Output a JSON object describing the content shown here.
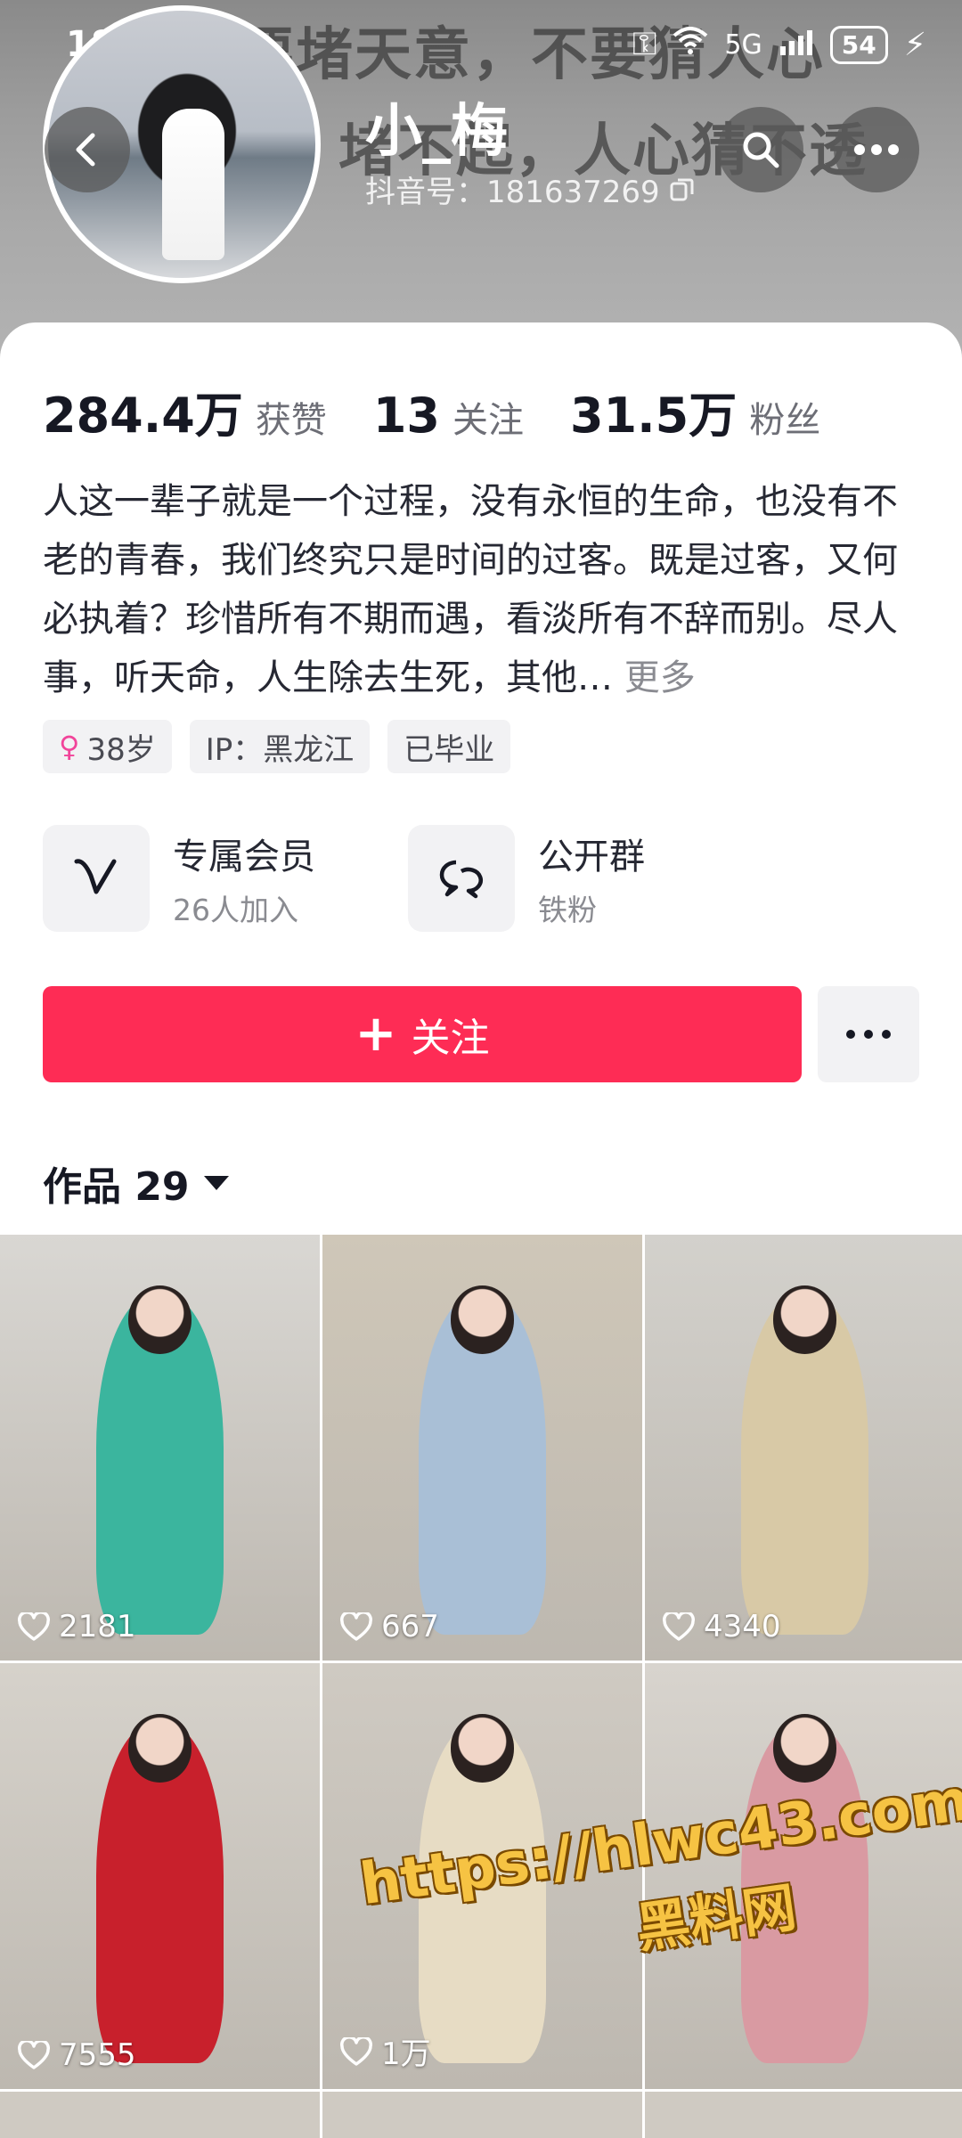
{
  "status_bar": {
    "time": "18:09",
    "network": "5G",
    "battery": "54"
  },
  "banner": {
    "line1": "不要堵天意，不要猜人心",
    "line2": "堵不起，人心猜不透"
  },
  "profile": {
    "username": "小_梅",
    "douyin_id": "抖音号：181637269"
  },
  "stats": [
    {
      "value": "284.4万",
      "label": "获赞"
    },
    {
      "value": "13",
      "label": "关注"
    },
    {
      "value": "31.5万",
      "label": "粉丝"
    }
  ],
  "bio": {
    "text": "人这一辈子就是一个过程，没有永恒的生命，也没有不老的青春，我们终究只是时间的过客。既是过客，又何必执着？珍惜所有不期而遇，看淡所有不辞而别。尽人事，听天命，人生除去生死，其他…",
    "more": "更多"
  },
  "tags": {
    "age": "38岁",
    "ip": "IP：黑龙江",
    "school": "已毕业"
  },
  "features": {
    "member_title": "专属会员",
    "member_sub": "26人加入",
    "group_title": "公开群",
    "group_sub": "铁粉"
  },
  "actions": {
    "follow_label": "关注"
  },
  "works": {
    "label": "作品 29"
  },
  "videos": [
    {
      "likes": "2181",
      "bg": "#d9d7d3",
      "outfit": "#3bb59e"
    },
    {
      "likes": "667",
      "bg": "#cfc7b8",
      "outfit": "#a9bfd6"
    },
    {
      "likes": "4340",
      "bg": "#d3d1cc",
      "outfit": "#d8c9a6"
    },
    {
      "likes": "7555",
      "bg": "#d6d2cb",
      "outfit": "#c8202c"
    },
    {
      "likes": "1万",
      "bg": "#cfcac2",
      "outfit": "#e7dcc4"
    },
    {
      "likes": "",
      "bg": "#d8d4ce",
      "outfit": "#d99aa2"
    }
  ],
  "watermark": {
    "url": "https://hlwc43.com",
    "name": "黑料网"
  },
  "colors": {
    "accent": "#fe2c55",
    "text_primary": "#161823",
    "text_secondary": "#8a8b91"
  }
}
